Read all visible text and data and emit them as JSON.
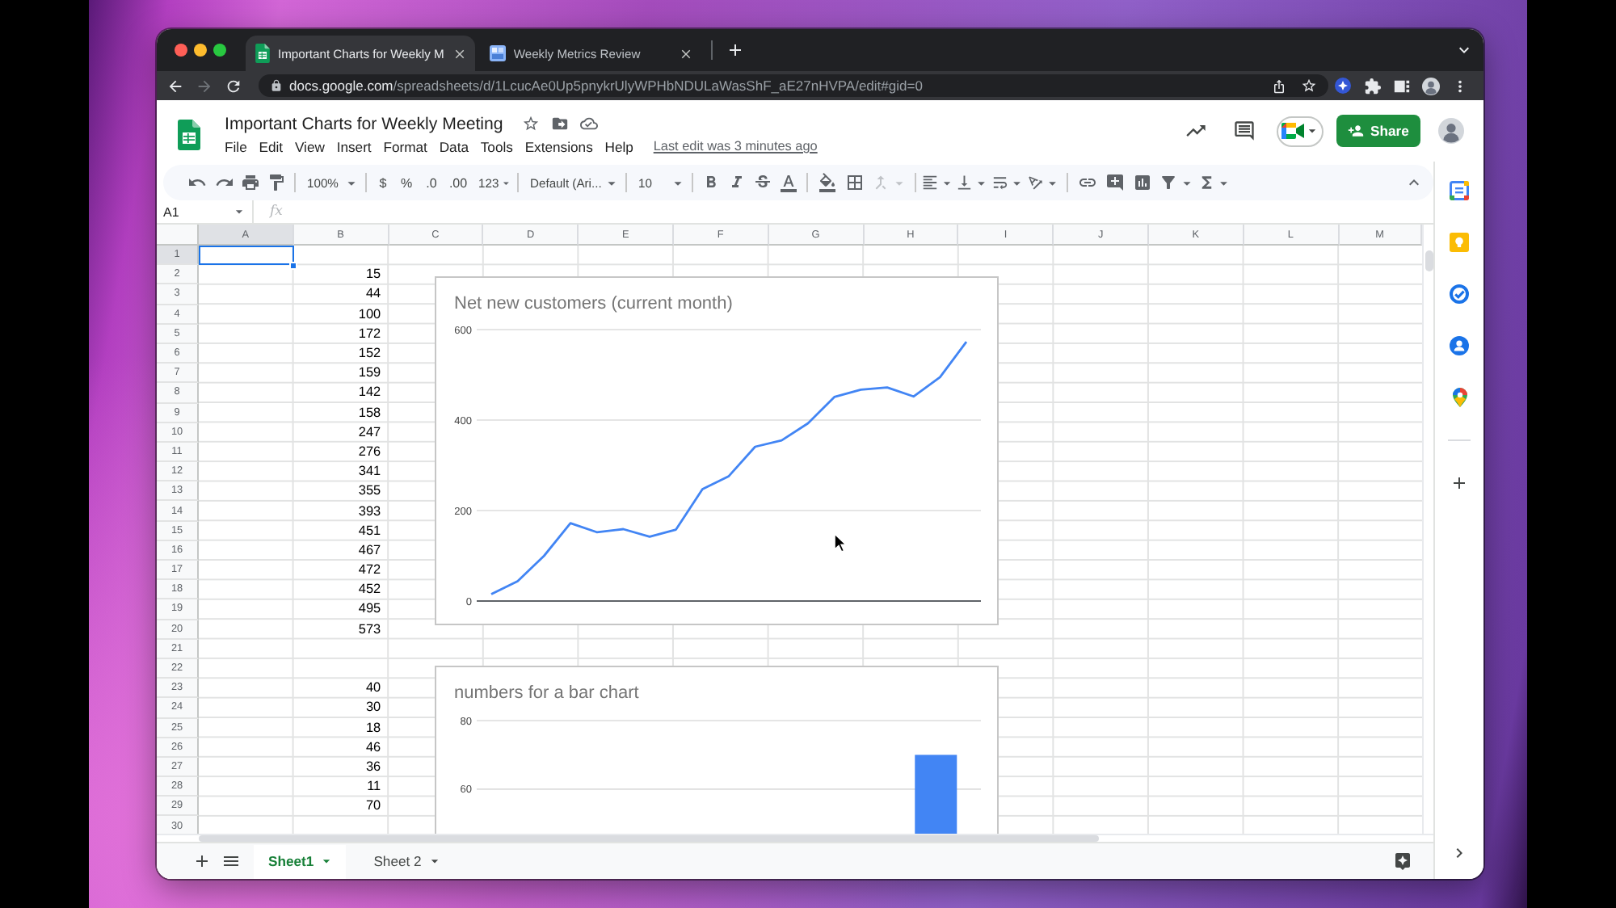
{
  "browser": {
    "tabs": [
      {
        "title": "Important Charts for Weekly M",
        "selected": true,
        "kind": "spreadsheet"
      },
      {
        "title": "Weekly Metrics Review",
        "selected": false,
        "kind": "image"
      }
    ],
    "nav_buttons": [
      {
        "kind": "back",
        "disabled": false
      },
      {
        "kind": "forward",
        "disabled": true
      },
      {
        "kind": "reload",
        "disabled": false
      }
    ],
    "url": {
      "host": "docs.google.com",
      "path": "/spreadsheets/d/1LcucAe0Up5pnykrUlyWPHbNDULaWasShF_aE27nHVPA/edit#gid=0"
    }
  },
  "document": {
    "title": "Important Charts for Weekly Meeting",
    "menu": [
      "File",
      "Edit",
      "View",
      "Insert",
      "Format",
      "Data",
      "Tools",
      "Extensions",
      "Help"
    ],
    "last_edit": "Last edit was 3 minutes ago",
    "share": "Share"
  },
  "toolbar": {
    "zoom": "100%",
    "currency": "$",
    "percent": "%",
    "decrease_decimals": ".0",
    "increase_decimals": ".00",
    "number_format": "123",
    "font": "Default (Ari...",
    "font_size": "10",
    "merge_cells": {
      "disabled": true
    }
  },
  "formula_bar": {
    "name_box": "A1",
    "fx": "fx"
  },
  "sheet": {
    "columns": [
      {
        "label": "A",
        "selected": true
      },
      {
        "label": "B",
        "selected": false
      },
      {
        "label": "C",
        "selected": false
      },
      {
        "label": "D",
        "selected": false
      },
      {
        "label": "E",
        "selected": false
      },
      {
        "label": "F",
        "selected": false
      },
      {
        "label": "G",
        "selected": false
      },
      {
        "label": "H",
        "selected": false
      },
      {
        "label": "I",
        "selected": false
      },
      {
        "label": "J",
        "selected": false
      },
      {
        "label": "K",
        "selected": false
      },
      {
        "label": "L",
        "selected": false
      },
      {
        "label": "M",
        "selected": false
      }
    ],
    "rows": [
      {
        "header": "1",
        "selected": true
      },
      {
        "header": "2",
        "selected": false,
        "b": "15"
      },
      {
        "header": "3",
        "selected": false,
        "b": "44"
      },
      {
        "header": "4",
        "selected": false,
        "b": "100"
      },
      {
        "header": "5",
        "selected": false,
        "b": "172"
      },
      {
        "header": "6",
        "selected": false,
        "b": "152"
      },
      {
        "header": "7",
        "selected": false,
        "b": "159"
      },
      {
        "header": "8",
        "selected": false,
        "b": "142"
      },
      {
        "header": "9",
        "selected": false,
        "b": "158"
      },
      {
        "header": "10",
        "selected": false,
        "b": "247"
      },
      {
        "header": "11",
        "selected": false,
        "b": "276"
      },
      {
        "header": "12",
        "selected": false,
        "b": "341"
      },
      {
        "header": "13",
        "selected": false,
        "b": "355"
      },
      {
        "header": "14",
        "selected": false,
        "b": "393"
      },
      {
        "header": "15",
        "selected": false,
        "b": "451"
      },
      {
        "header": "16",
        "selected": false,
        "b": "467"
      },
      {
        "header": "17",
        "selected": false,
        "b": "472"
      },
      {
        "header": "18",
        "selected": false,
        "b": "452"
      },
      {
        "header": "19",
        "selected": false,
        "b": "495"
      },
      {
        "header": "20",
        "selected": false,
        "b": "573"
      },
      {
        "header": "21",
        "selected": false
      },
      {
        "header": "22",
        "selected": false
      },
      {
        "header": "23",
        "selected": false,
        "b": "40"
      },
      {
        "header": "24",
        "selected": false,
        "b": "30"
      },
      {
        "header": "25",
        "selected": false,
        "b": "18"
      },
      {
        "header": "26",
        "selected": false,
        "b": "46"
      },
      {
        "header": "27",
        "selected": false,
        "b": "36"
      },
      {
        "header": "28",
        "selected": false,
        "b": "11"
      },
      {
        "header": "29",
        "selected": false,
        "b": "70"
      },
      {
        "header": "30",
        "selected": false
      }
    ]
  },
  "charts": [
    {
      "chart_data": {
        "type": "line",
        "title": "Net new customers (current month)",
        "ylim": [
          0,
          600
        ],
        "yticks": [
          0,
          200,
          400,
          600
        ],
        "values": [
          15,
          44,
          100,
          172,
          152,
          159,
          142,
          158,
          247,
          276,
          341,
          355,
          393,
          451,
          467,
          472,
          452,
          495,
          573
        ]
      }
    },
    {
      "chart_data": {
        "type": "bar",
        "title": "numbers for a bar chart",
        "ylim": [
          47,
          80
        ],
        "yticks": [
          60,
          80
        ],
        "values": [
          null,
          null,
          null,
          null,
          null,
          null,
          70
        ]
      }
    }
  ],
  "sheet_tabs": [
    {
      "label": "Sheet1",
      "selected": true
    },
    {
      "label": "Sheet 2",
      "selected": false
    }
  ]
}
